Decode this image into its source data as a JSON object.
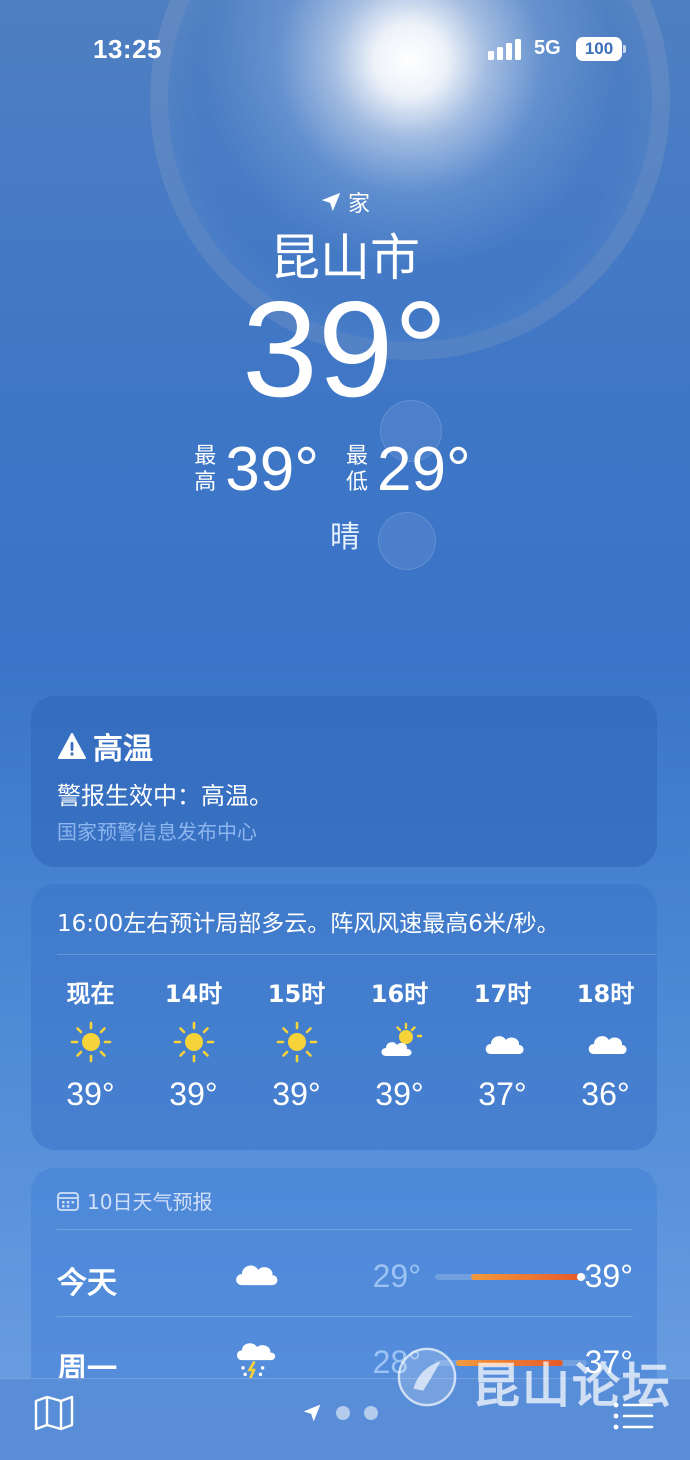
{
  "status_bar": {
    "time": "13:25",
    "network": "5G",
    "battery": "100"
  },
  "header": {
    "location_label": "家",
    "city": "昆山市",
    "temperature": "39°",
    "high_label": "最高",
    "high": "39°",
    "low_label": "最低",
    "low": "29°",
    "condition": "晴"
  },
  "alert": {
    "title": "高温",
    "text": "警报生效中：高温。",
    "source": "国家预警信息发布中心"
  },
  "hourly": {
    "summary": "16:00左右预计局部多云。阵风风速最高6米/秒。",
    "hours": [
      {
        "label": "现在",
        "icon": "sun-icon",
        "temp": "39°"
      },
      {
        "label": "14时",
        "icon": "sun-icon",
        "temp": "39°"
      },
      {
        "label": "15时",
        "icon": "sun-icon",
        "temp": "39°"
      },
      {
        "label": "16时",
        "icon": "partly-cloudy-icon",
        "temp": "39°"
      },
      {
        "label": "17时",
        "icon": "cloud-icon",
        "temp": "37°"
      },
      {
        "label": "18时",
        "icon": "cloud-icon",
        "temp": "36°"
      }
    ]
  },
  "daily": {
    "title": "10日天气预报",
    "days": [
      {
        "day": "今天",
        "icon": "cloud-icon",
        "low": "29°",
        "high": "39°",
        "bar_start": 0.24,
        "bar_end": 0.96,
        "current": 0.96
      },
      {
        "day": "周一",
        "icon": "thunderstorm-icon",
        "low": "28°",
        "high": "37°",
        "bar_start": 0.14,
        "bar_end": 0.84
      }
    ]
  },
  "watermark": {
    "text": "昆山论坛"
  },
  "colors": {
    "accent_orange": "#e55a2b",
    "alert_source": "#8db6ee",
    "sun_yellow": "#f7d33a"
  }
}
